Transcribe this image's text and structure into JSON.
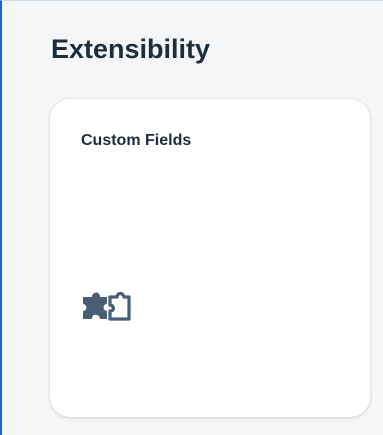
{
  "section": {
    "title": "Extensibility"
  },
  "tile": {
    "title": "Custom Fields",
    "icon": "puzzle-piece-icon"
  },
  "colors": {
    "accent_border": "#0a6ed1",
    "title_text": "#1d2d3e",
    "icon": "#475e75",
    "page_background": "#f5f6f7",
    "tile_background": "#ffffff"
  }
}
